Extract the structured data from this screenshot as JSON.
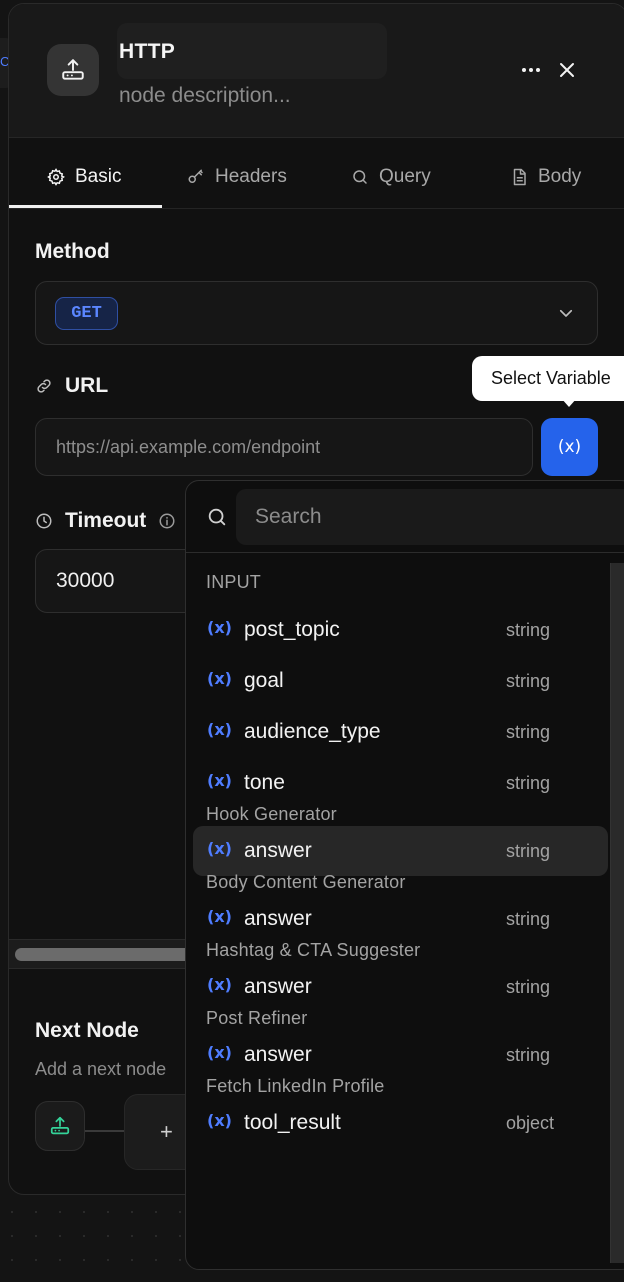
{
  "header": {
    "title": "HTTP",
    "description_placeholder": "node description..."
  },
  "tabs": [
    {
      "label": "Basic",
      "icon": "gear-icon",
      "active": true
    },
    {
      "label": "Headers",
      "icon": "key-icon",
      "active": false
    },
    {
      "label": "Query",
      "icon": "search-icon",
      "active": false
    },
    {
      "label": "Body",
      "icon": "document-icon",
      "active": false
    }
  ],
  "method": {
    "label": "Method",
    "value": "GET"
  },
  "url": {
    "label": "URL",
    "placeholder": "https://api.example.com/endpoint",
    "variable_button": "(x)"
  },
  "tooltip": "Select Variable",
  "timeout": {
    "label": "Timeout",
    "value": "30000"
  },
  "next_node": {
    "title": "Next Node",
    "description": "Add a next node",
    "add_label": "+"
  },
  "dropdown": {
    "search_placeholder": "Search",
    "groups": [
      {
        "label": "INPUT",
        "vars": [
          {
            "name": "post_topic",
            "type": "string"
          },
          {
            "name": "goal",
            "type": "string"
          },
          {
            "name": "audience_type",
            "type": "string"
          },
          {
            "name": "tone",
            "type": "string"
          }
        ]
      },
      {
        "label": "Hook Generator",
        "vars": [
          {
            "name": "answer",
            "type": "string",
            "highlighted": true
          }
        ]
      },
      {
        "label": "Body Content Generator",
        "vars": [
          {
            "name": "answer",
            "type": "string"
          }
        ]
      },
      {
        "label": "Hashtag & CTA Suggester",
        "vars": [
          {
            "name": "answer",
            "type": "string"
          }
        ]
      },
      {
        "label": "Post Refiner",
        "vars": [
          {
            "name": "answer",
            "type": "string"
          }
        ]
      },
      {
        "label": "Fetch LinkedIn Profile",
        "vars": [
          {
            "name": "tool_result",
            "type": "object"
          }
        ]
      }
    ],
    "var_icon": "(x)"
  },
  "colors": {
    "accent": "#2563eb",
    "var_icon": "#4f7dff",
    "node_icon_green": "#34d399"
  }
}
